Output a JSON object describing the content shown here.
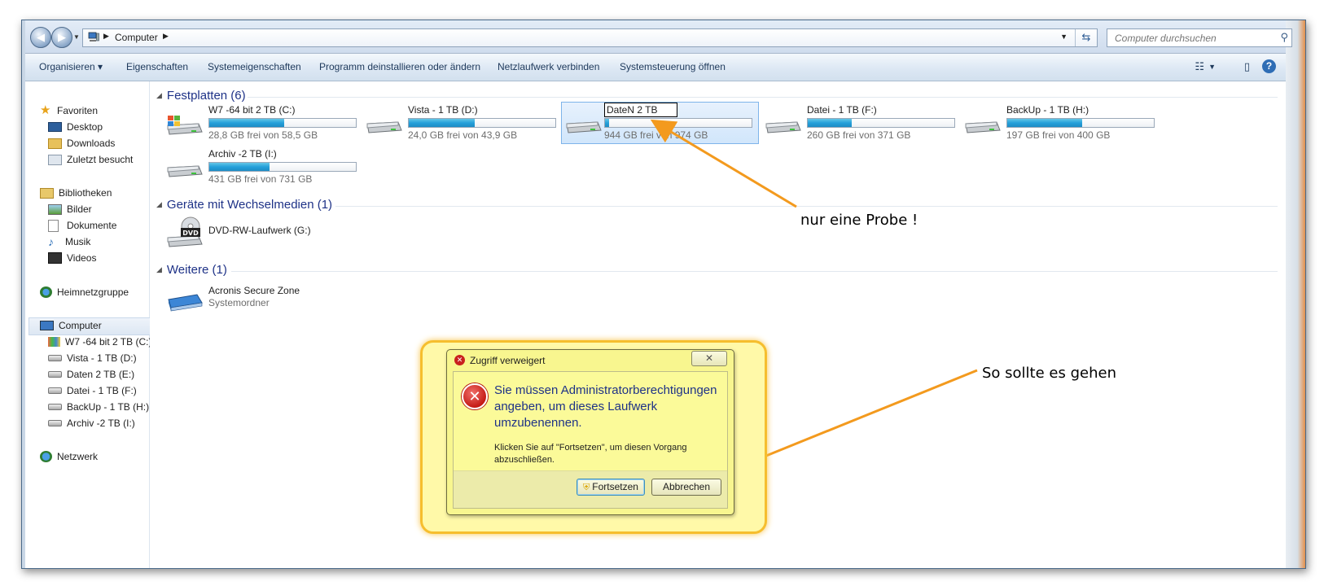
{
  "address": {
    "crumb": "Computer",
    "search_placeholder": "Computer durchsuchen"
  },
  "toolbar": {
    "items": [
      "Organisieren ▾",
      "Eigenschaften",
      "Systemeigenschaften",
      "Programm deinstallieren oder ändern",
      "Netzlaufwerk verbinden",
      "Systemsteuerung öffnen"
    ],
    "help": "?"
  },
  "nav": {
    "favorites": "Favoriten",
    "desktop": "Desktop",
    "downloads": "Downloads",
    "recent": "Zuletzt besucht",
    "libraries": "Bibliotheken",
    "pictures": "Bilder",
    "documents": "Dokumente",
    "music": "Musik",
    "videos": "Videos",
    "homegroup": "Heimnetzgruppe",
    "computer": "Computer",
    "drives": [
      "W7 -64 bit 2 TB (C:)",
      "Vista - 1 TB (D:)",
      "Daten 2 TB (E:)",
      "Datei - 1 TB (F:)",
      "BackUp - 1 TB (H:)",
      "Archiv -2 TB (I:)"
    ],
    "network": "Netzwerk"
  },
  "groups": {
    "hdd": "Festplatten (6)",
    "removable": "Geräte mit Wechselmedien (1)",
    "other": "Weitere (1)"
  },
  "drives": [
    {
      "name": "W7 -64 bit 2 TB (C:)",
      "free": "28,8 GB frei von 58,5 GB",
      "used_fraction": 0.51
    },
    {
      "name": "Vista - 1 TB (D:)",
      "free": "24,0 GB frei von 43,9 GB",
      "used_fraction": 0.45
    },
    {
      "name": "DateN  2 TB",
      "free": "944 GB frei von 974 GB",
      "used_fraction": 0.03
    },
    {
      "name": "Datei - 1 TB (F:)",
      "free": "260 GB frei von 371 GB",
      "used_fraction": 0.3
    },
    {
      "name": "BackUp - 1 TB (H:)",
      "free": "197 GB frei von 400 GB",
      "used_fraction": 0.51
    },
    {
      "name": "Archiv -2 TB (I:)",
      "free": "431 GB frei von 731 GB",
      "used_fraction": 0.41
    }
  ],
  "removable": {
    "name": "DVD-RW-Laufwerk (G:)",
    "dvd_label": "DVD"
  },
  "other": {
    "name": "Acronis Secure Zone",
    "type": "Systemordner"
  },
  "annotations": {
    "first": "nur eine Probe !",
    "second": "So sollte es gehen"
  },
  "dialog": {
    "title": "Zugriff verweigert",
    "message": "Sie müssen Administratorberechtigungen angeben, um dieses Laufwerk umzubenennen.",
    "sub": "Klicken Sie auf \"Fortsetzen\", um diesen Vorgang abzuschließen.",
    "continue": "Fortsetzen",
    "cancel": "Abbrechen"
  },
  "colors": {
    "annotation_arrow": "#f39a1e",
    "dialog_bg": "#f8f68f",
    "halo_border": "#f6be2e",
    "group_title": "#1e3287",
    "bar_fill": "#26a0da"
  }
}
